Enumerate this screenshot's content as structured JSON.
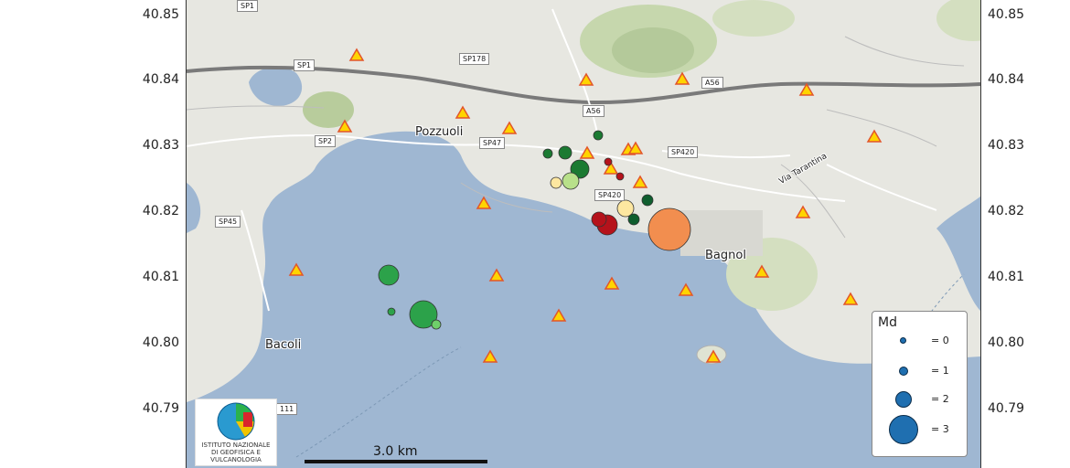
{
  "axes": {
    "lat_ticks": [
      "40.85",
      "40.84",
      "40.83",
      "40.82",
      "40.81",
      "40.80",
      "40.79"
    ]
  },
  "roads": [
    "SP1",
    "SP1",
    "SP178",
    "A56",
    "A56",
    "SP47",
    "SP420",
    "SP420",
    "SP2",
    "SP45",
    "111"
  ],
  "places": {
    "pozzuoli": "Pozzuoli",
    "bagnoli": "Bagnol",
    "bacoli": "Bacoli",
    "street": "Via Tarantina"
  },
  "legend": {
    "title": "Md",
    "entries": [
      {
        "label": "= 0",
        "magnitude": 0
      },
      {
        "label": "= 1",
        "magnitude": 1
      },
      {
        "label": "= 2",
        "magnitude": 2
      },
      {
        "label": "= 3",
        "magnitude": 3
      }
    ]
  },
  "scale": {
    "label": "3.0 km"
  },
  "logo": {
    "text": "ISTITUTO NAZIONALE DI GEOFISICA E VULCANOLOGIA"
  },
  "colors": {
    "sea": "#9fb7d2",
    "land": "#e7e7e1",
    "station_fill": "#ffd400",
    "station_stroke": "#e2552a",
    "legend_dot": "#1f6fb0"
  }
}
